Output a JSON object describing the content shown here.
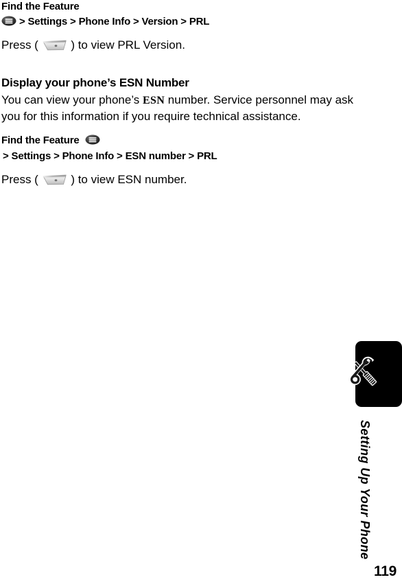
{
  "document": {
    "page_number": "119",
    "side_tab_label": "Setting Up Your Phone",
    "side_tab_icon": "wrench-screwdriver-icon"
  },
  "sections": [
    {
      "find_the_feature_label": "Find the Feature",
      "menu_icon": "menu-oval-icon",
      "breadcrumb": "> Settings > Phone Info > Version > PRL",
      "press_prefix": "Press (",
      "softkey_icon": "softkey-button-icon",
      "press_suffix": ") to view PRL Version."
    },
    {
      "title": "Display your phone’s ESN Number",
      "body_before_esn": "You can view your phone’s ",
      "body_esn": "ESN",
      "body_after_esn": " number. Service personnel may ask you for this information if you require technical assistance.",
      "find_the_feature_label": "Find the Feature",
      "menu_icon": "menu-oval-icon",
      "breadcrumb": "> Settings > Phone Info > ESN number > PRL",
      "press_prefix": "Press (",
      "softkey_icon": "softkey-button-icon",
      "press_suffix": ") to view ESN number."
    }
  ],
  "colors": {
    "tab_background": "#000000",
    "text": "#000000",
    "page_background": "#ffffff",
    "softkey_light": "#e8e8e8",
    "softkey_mid": "#c9c9c9",
    "softkey_dark": "#8a8a8a"
  }
}
